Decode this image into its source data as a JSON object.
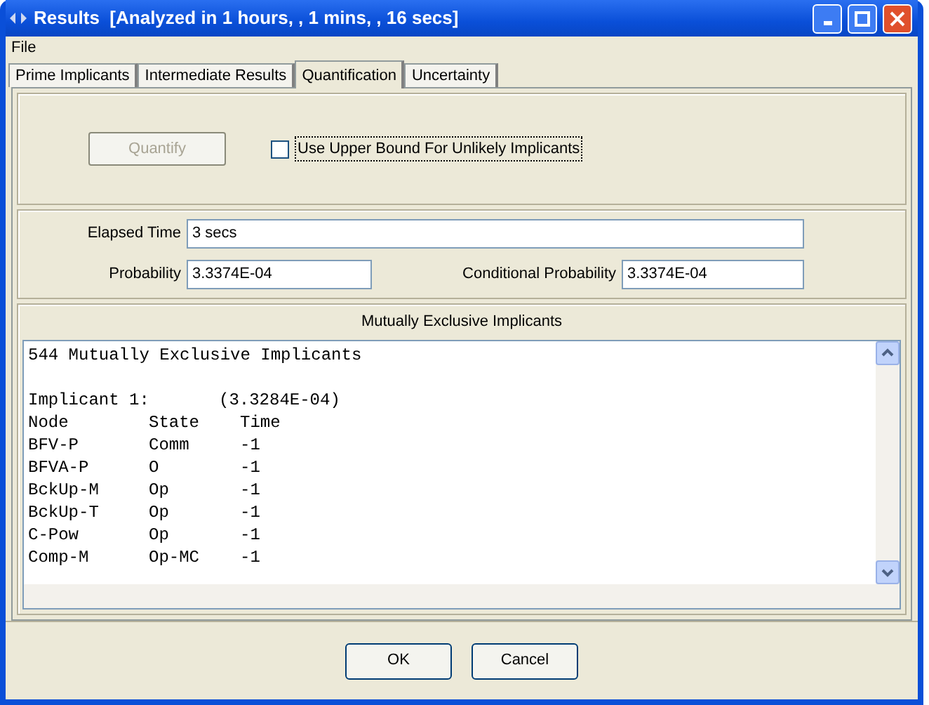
{
  "window": {
    "title": "Results  [Analyzed in 1 hours, , 1 mins, , 16 secs]"
  },
  "menu": [
    "File"
  ],
  "tabs": [
    {
      "label": "Prime Implicants",
      "selected": false
    },
    {
      "label": "Intermediate Results",
      "selected": false
    },
    {
      "label": "Quantification",
      "selected": true
    },
    {
      "label": "Uncertainty",
      "selected": false
    }
  ],
  "quantify_button": {
    "label": "Quantify",
    "disabled": true
  },
  "upper_bound_checkbox": {
    "label": "Use Upper Bound For Unlikely Implicants",
    "checked": false
  },
  "elapsed_time": {
    "label": "Elapsed Time",
    "value": "3 secs"
  },
  "probability": {
    "label": "Probability",
    "value": "3.3374E-04"
  },
  "conditional_probability": {
    "label": "Conditional Probability",
    "value": "3.3374E-04"
  },
  "implicants": {
    "title": "Mutually Exclusive Implicants",
    "summary": "544 Mutually Exclusive Implicants",
    "implicant_label": "Implicant 1:",
    "implicant_value": "(3.3284E-04)",
    "columns": [
      "Node",
      "State",
      "Time"
    ],
    "rows": [
      [
        "BFV-P",
        "Comm",
        "-1"
      ],
      [
        "BFVA-P",
        "O",
        "-1"
      ],
      [
        "BckUp-M",
        "Op",
        "-1"
      ],
      [
        "BckUp-T",
        "Op",
        "-1"
      ],
      [
        "C-Pow",
        "Op",
        "-1"
      ],
      [
        "Comp-M",
        "Op-MC",
        "-1"
      ]
    ]
  },
  "buttons": [
    "OK",
    "Cancel"
  ]
}
